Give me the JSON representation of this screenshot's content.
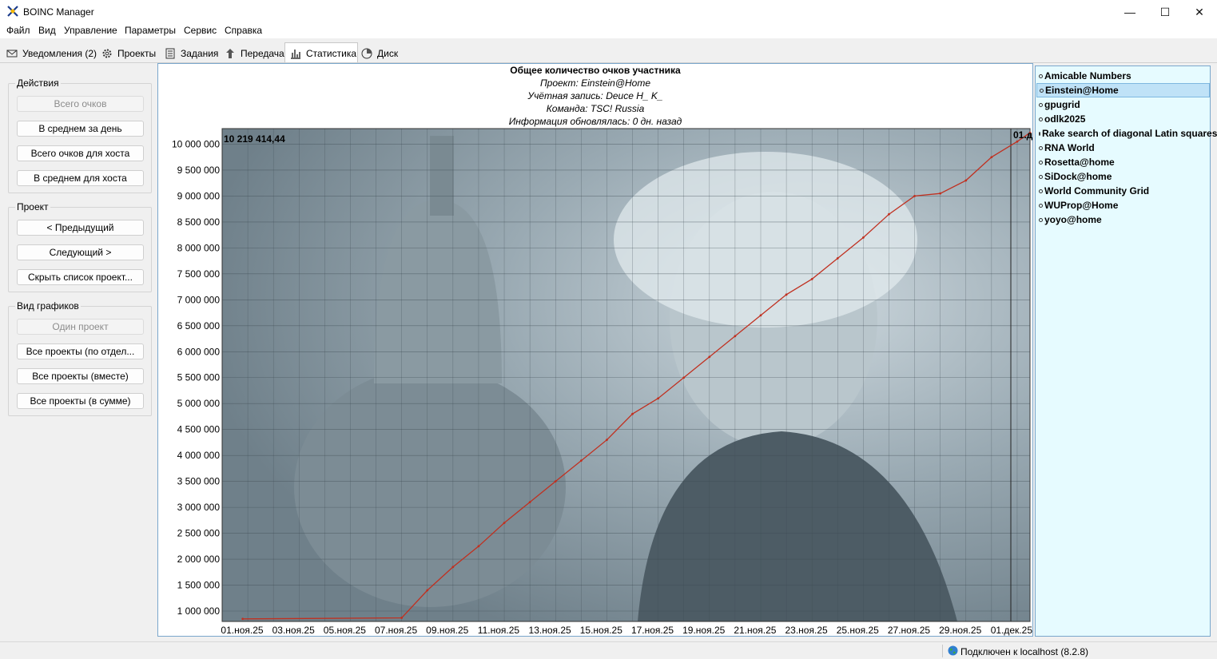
{
  "window": {
    "title": "BOINC Manager",
    "min": "—",
    "max": "☐",
    "close": "✕"
  },
  "menu": [
    "Файл",
    "Вид",
    "Управление",
    "Параметры",
    "Сервис",
    "Справка"
  ],
  "tabs": [
    {
      "label": "Уведомления (2)",
      "icon": "envelope-icon",
      "active": false
    },
    {
      "label": "Проекты",
      "icon": "gear-icon",
      "active": false
    },
    {
      "label": "Задания",
      "icon": "document-icon",
      "active": false
    },
    {
      "label": "Передача",
      "icon": "transfer-icon",
      "active": false
    },
    {
      "label": "Статистика",
      "icon": "bar-chart-icon",
      "active": true
    },
    {
      "label": "Диск",
      "icon": "disk-icon",
      "active": false
    }
  ],
  "sidebar": {
    "actions": {
      "title": "Действия",
      "buttons": [
        {
          "label": "Всего очков",
          "disabled": true
        },
        {
          "label": "В среднем за день",
          "disabled": false
        },
        {
          "label": "Всего очков для хоста",
          "disabled": false
        },
        {
          "label": "В среднем для хоста",
          "disabled": false
        }
      ]
    },
    "project": {
      "title": "Проект",
      "buttons": [
        {
          "label": "< Предыдущий",
          "disabled": false
        },
        {
          "label": "Следующий >",
          "disabled": false
        },
        {
          "label": "Скрыть список проект...",
          "disabled": false
        }
      ]
    },
    "graph_view": {
      "title": "Вид графиков",
      "buttons": [
        {
          "label": "Один проект",
          "disabled": true
        },
        {
          "label": "Все проекты (по отдел...",
          "disabled": false
        },
        {
          "label": "Все проекты (вместе)",
          "disabled": false
        },
        {
          "label": "Все проекты (в сумме)",
          "disabled": false
        }
      ]
    }
  },
  "chart_data": {
    "type": "line",
    "header_lines": [
      "Общее количество очков участника",
      "Проект: Einstein@Home",
      "Учётная запись: Deuce H_ K_",
      "Команда: TSC! Russia",
      "Информация обновлялась: 0 дн. назад"
    ],
    "max_label": "10 219 414,44",
    "right_edge_label": "01.д",
    "y_ticks": [
      1000000,
      1500000,
      2000000,
      2500000,
      3000000,
      3500000,
      4000000,
      4500000,
      5000000,
      5500000,
      6000000,
      6500000,
      7000000,
      7500000,
      8000000,
      8500000,
      9000000,
      9500000,
      10000000
    ],
    "y_tick_labels": [
      "1 000 000",
      "1 500 000",
      "2 000 000",
      "2 500 000",
      "3 000 000",
      "3 500 000",
      "4 000 000",
      "4 500 000",
      "5 000 000",
      "5 500 000",
      "6 000 000",
      "6 500 000",
      "7 000 000",
      "7 500 000",
      "8 000 000",
      "8 500 000",
      "9 000 000",
      "9 500 000",
      "10 000 000"
    ],
    "ylim": [
      800000,
      10300000
    ],
    "x_tick_labels": [
      "01.ноя.25",
      "03.ноя.25",
      "05.ноя.25",
      "07.ноя.25",
      "09.ноя.25",
      "11.ноя.25",
      "13.ноя.25",
      "15.ноя.25",
      "17.ноя.25",
      "19.ноя.25",
      "21.ноя.25",
      "23.ноя.25",
      "25.ноя.25",
      "27.ноя.25",
      "29.ноя.25",
      "01.дек.25"
    ],
    "x_range_days": [
      0,
      31.5
    ],
    "grid": true,
    "background_image": "photo of Albert Einstein beside a metal still",
    "series": [
      {
        "color": "#c03020",
        "x_days": [
          0.8,
          7.0,
          8.0,
          9.0,
          10.0,
          11.0,
          12.0,
          13.0,
          14.0,
          15.0,
          16.0,
          17.0,
          18.0,
          19.0,
          20.0,
          21.0,
          22.0,
          23.0,
          24.0,
          25.0,
          26.0,
          27.0,
          28.0,
          29.0,
          30.0,
          31.0,
          31.5
        ],
        "y": [
          850000,
          870000,
          1400000,
          1850000,
          2250000,
          2700000,
          3100000,
          3500000,
          3900000,
          4300000,
          4800000,
          5100000,
          5500000,
          5900000,
          6300000,
          6700000,
          7100000,
          7400000,
          7800000,
          8200000,
          8650000,
          9000000,
          9050000,
          9300000,
          9750000,
          10050000,
          10219414
        ]
      }
    ]
  },
  "projects": [
    {
      "name": "Amicable Numbers",
      "selected": false
    },
    {
      "name": "Einstein@Home",
      "selected": true
    },
    {
      "name": "gpugrid",
      "selected": false
    },
    {
      "name": "odlk2025",
      "selected": false
    },
    {
      "name": "Rake search of diagonal Latin squares",
      "selected": false
    },
    {
      "name": "RNA World",
      "selected": false
    },
    {
      "name": "Rosetta@home",
      "selected": false
    },
    {
      "name": "SiDock@home",
      "selected": false
    },
    {
      "name": "World Community Grid",
      "selected": false
    },
    {
      "name": "WUProp@Home",
      "selected": false
    },
    {
      "name": "yoyo@home",
      "selected": false
    }
  ],
  "status": {
    "connection": "Подключен к localhost (8.2.8)"
  }
}
